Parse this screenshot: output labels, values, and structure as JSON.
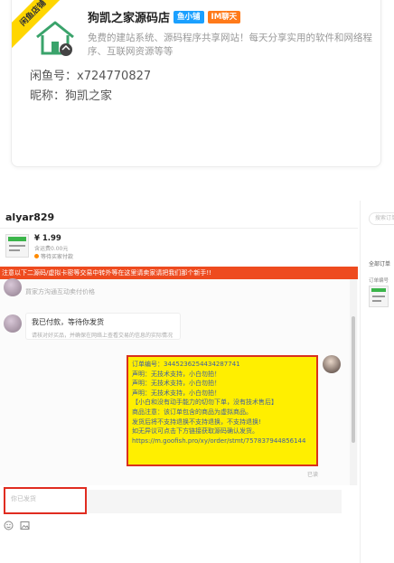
{
  "shop": {
    "ribbon": "闲鱼店铺",
    "name": "狗凯之家源码店",
    "tags": [
      "鱼小铺",
      "IM聊天"
    ],
    "description": "免费的建站系统、源码程序共享网站！每天分享实用的软件和网络程序、互联网资源等等",
    "xianyu_id": "闲鱼号：x724770827",
    "nickname": "昵称：狗凯之家"
  },
  "chat": {
    "username": "alyar829",
    "item": {
      "price": "¥ 1.99",
      "shipping": "含运费0.00元",
      "status": "等待买家付款"
    },
    "notice": "注意以下二源码/虚拟卡密等交易中转外等在这里请卖家请把我们那个新手!!",
    "system_message": "買家方沟通互动卖付价格",
    "buyer_bubble": {
      "title": "我已付款，等待你发货",
      "subtitle": "请核对好买品，并确保在网络上查看交易的信息的实际情况"
    },
    "order_bubble_lines": [
      "订单编号：3445236254434287741",
      "声明：无技术支持，小白勿拍！",
      "声明：无技术支持，小白勿拍！",
      "声明：无技术支持，小白勿拍！",
      "【小白和没有动手能力的切勿下单，没有技术售后】",
      "商品注意：该订单包含的商品为虚拟商品。",
      "发货后将不支持退换不支持退换，不支持退换!",
      "如无异议可点击下方链接获取源码确认发货。",
      "https://m.goofish.pro/xy/order/stmt/757837944856144"
    ],
    "read_mark": "已读",
    "input_placeholder": "你已发货"
  },
  "right_panel": {
    "search_placeholder": "搜索订单",
    "label": "全部订单",
    "order_no": "订单编号"
  },
  "colors": {
    "notice_bar": "#ee4b1f",
    "order_bubble_bg": "#ffef00",
    "highlight_border": "#d9311d",
    "tag_blue": "#1aa0ff",
    "tag_orange": "#ff7a1a"
  },
  "icons": [
    "emoji-icon",
    "image-icon"
  ]
}
